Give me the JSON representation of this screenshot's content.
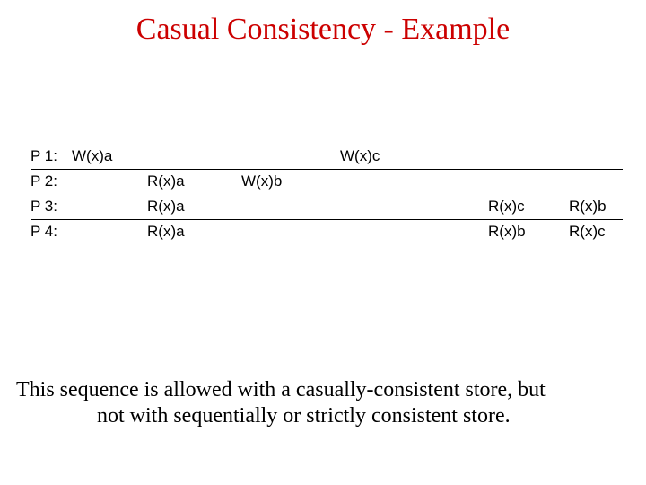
{
  "title": "Casual Consistency - Example",
  "rows": {
    "p1": {
      "label": "P 1:",
      "c1": "W(x)a",
      "c4": "W(x)c"
    },
    "p2": {
      "label": "P 2:",
      "c2": "R(x)a",
      "c3": "W(x)b"
    },
    "p3": {
      "label": "P 3:",
      "c2": "R(x)a",
      "c5": "R(x)c",
      "c6": "R(x)b"
    },
    "p4": {
      "label": "P 4:",
      "c2": "R(x)a",
      "c5": "R(x)b",
      "c6": "R(x)c"
    }
  },
  "caption": {
    "line1": "This sequence is allowed with a casually-consistent store, but",
    "line2": "not with sequentially or strictly consistent store."
  }
}
